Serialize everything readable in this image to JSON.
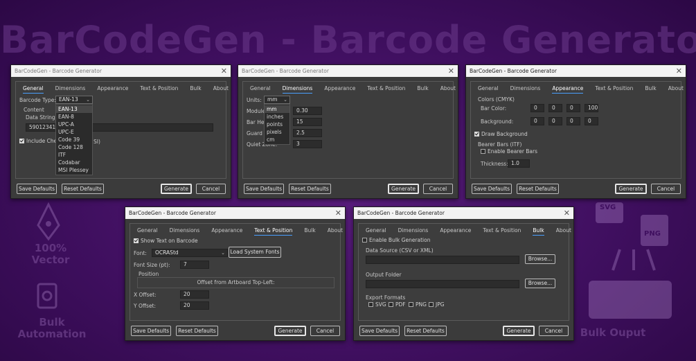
{
  "background": {
    "title": "BarCodeGen - Barcode Generator",
    "left_words": [
      "100%",
      "Vector",
      "Bulk",
      "Automation"
    ],
    "right_words": [
      "Bulk Ouput"
    ],
    "icon_labels": [
      "SVG",
      "PNG"
    ]
  },
  "window_title": "BarCodeGen - Barcode Generator",
  "tabs": [
    "General",
    "Dimensions",
    "Appearance",
    "Text & Position",
    "Bulk",
    "About"
  ],
  "buttons": {
    "save_defaults": "Save Defaults",
    "reset_defaults": "Reset Defaults",
    "generate": "Generate",
    "cancel": "Cancel"
  },
  "general": {
    "barcode_type_label": "Barcode Type:",
    "barcode_type_value": "EAN-13",
    "content_label": "Content",
    "data_string_label": "Data String:",
    "data_string_value": "5901234123",
    "checksum_label_left": "Include Chec",
    "checksum_label_right": "SI)",
    "type_options": [
      "EAN-13",
      "EAN-8",
      "UPC-A",
      "UPC-E",
      "Code 39",
      "Code 128",
      "ITF",
      "Codabar",
      "MSI Plessey"
    ]
  },
  "dimensions": {
    "units_label": "Units:",
    "units_value": "mm",
    "module_label": "Module",
    "module_value": "0.30",
    "bar_height_label": "Bar Heig",
    "bar_height_value": "15",
    "guard_label": "Guard E",
    "guard_value": "2.5",
    "quiet_label": "Quiet Zone:",
    "quiet_value": "3",
    "unit_options": [
      "mm",
      "inches",
      "points",
      "pixels",
      "cm"
    ]
  },
  "appearance": {
    "colors_label": "Colors (CMYK)",
    "bar_color_label": "Bar Color:",
    "bar_color": [
      "0",
      "0",
      "0",
      "100"
    ],
    "background_label": "Background:",
    "background_color": [
      "0",
      "0",
      "0",
      "0"
    ],
    "draw_background_label": "Draw Background",
    "bearer_label": "Bearer Bars (ITF)",
    "enable_bearer_label": "Enable Bearer Bars",
    "thickness_label": "Thickness:",
    "thickness_value": "1.0"
  },
  "text_position": {
    "show_text_label": "Show Text on Barcode",
    "font_label": "Font:",
    "font_value": "OCRAStd",
    "load_fonts_label": "Load System Fonts",
    "font_size_label": "Font Size (pt):",
    "font_size_value": "7",
    "position_label": "Position",
    "offset_note": "Offset from Artboard Top-Left:",
    "x_offset_label": "X Offset:",
    "x_offset_value": "20",
    "y_offset_label": "Y Offset:",
    "y_offset_value": "20"
  },
  "bulk": {
    "enable_label": "Enable Bulk Generation",
    "data_source_label": "Data Source (CSV or XML)",
    "output_folder_label": "Output Folder",
    "browse_label": "Browse...",
    "export_formats_label": "Export Formats",
    "formats": [
      "SVG",
      "PDF",
      "PNG",
      "JPG"
    ]
  }
}
